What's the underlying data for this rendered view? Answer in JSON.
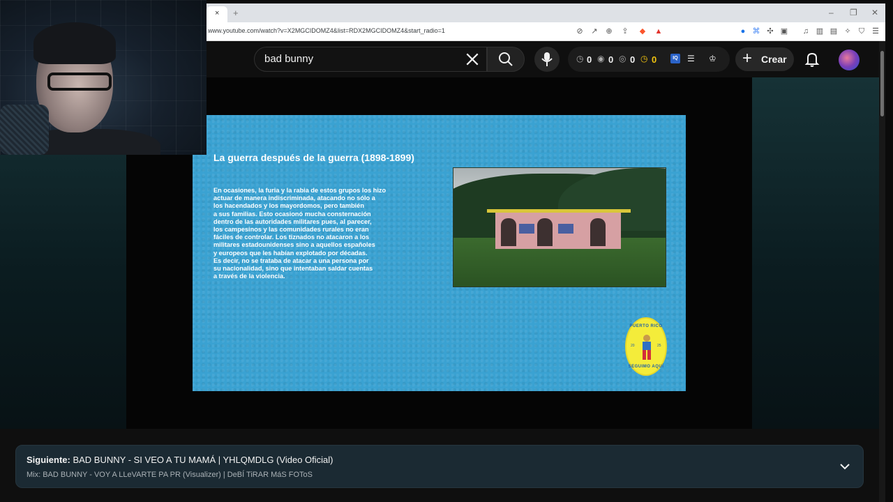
{
  "browser": {
    "url": "www.youtube.com/watch?v=X2MGCIDOMZ4&list=RDX2MGCIDOMZ4&start_radio=1",
    "tab_close": "×",
    "new_tab": "+"
  },
  "window_controls": {
    "minimize": "–",
    "restore": "❐",
    "close": "✕"
  },
  "header": {
    "search_value": "bad bunny",
    "stats": [
      "0",
      "0",
      "0",
      "0"
    ],
    "create_label": "Crear",
    "stat_color_highlight": "#f2c40f"
  },
  "slide": {
    "title": "La guerra después de la guerra (1898-1899)",
    "body": "En ocasiones, la furia y la rabia de estos grupos los hizo\nactuar de manera indiscriminada, atacando no sólo a\nlos hacendados y los mayordomos, pero también\na sus familias. Esto ocasionó mucha consternación\ndentro de las autoridades militares pues, al parecer,\nlos campesinos y las comunidades rurales no eran\nfáciles de controlar. Los tiznados no atacaron a los\nmilitares estadounidenses sino a aquellos españoles\ny europeos que les habían explotado por décadas.\nEs decir, no se trataba de atacar a una persona por\nsu nacionalidad, sino que intentaban saldar cuentas\na través de la violencia.",
    "background": "#3aa2d2",
    "logo": {
      "top_text": "PUERTO RICO",
      "bottom_text": "SEGUIMO AQUÍ",
      "left_num": "20",
      "right_num": "25"
    }
  },
  "next_up": {
    "prefix": "Siguiente:",
    "title": "BAD BUNNY - SI VEO A TU MAMÁ | YHLQMDLG (Video Oficial)",
    "mix": "Mix: BAD BUNNY - VOY A LLeVARTE PA PR (Visualizer) | DeBÍ TiRAR MáS FOToS"
  }
}
